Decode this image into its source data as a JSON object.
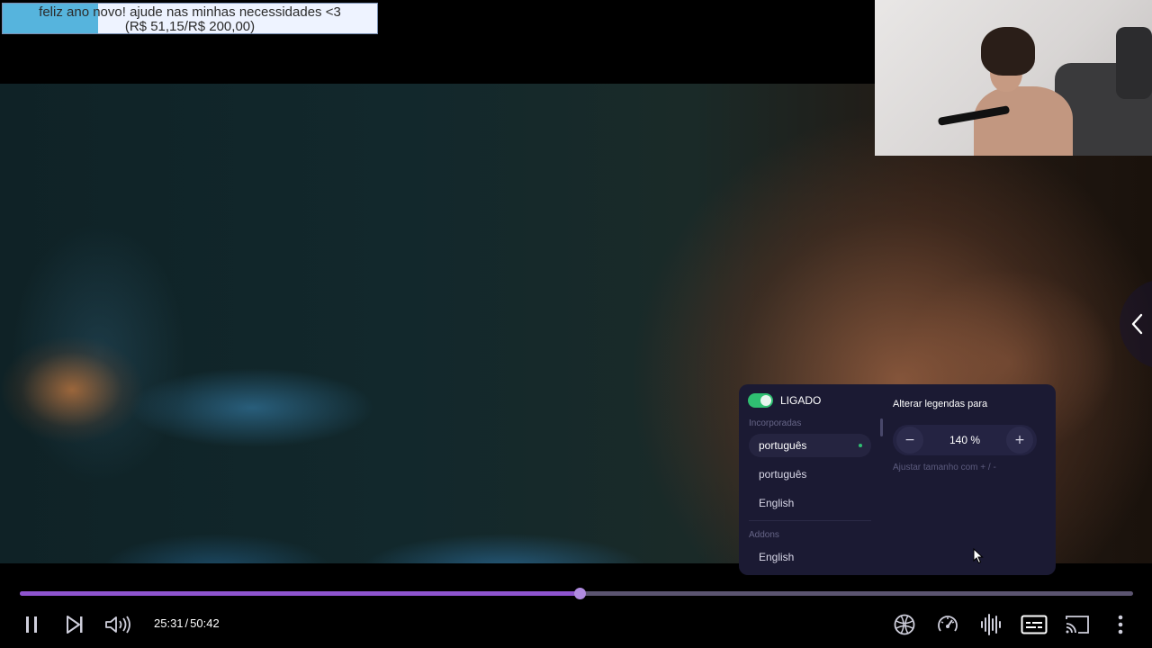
{
  "donation": {
    "line1": "feliz ano novo! ajude nas minhas necessidades <3",
    "line2": "(R$ 51,15/R$ 200,00)",
    "progress_fraction": 0.2558,
    "fill_color": "#56b4dd"
  },
  "subtitles_panel": {
    "toggle_label": "LIGADO",
    "toggle_on": true,
    "embedded_group_label": "Incorporadas",
    "embedded_tracks": [
      {
        "label": "português",
        "selected": true
      },
      {
        "label": "português",
        "selected": false
      },
      {
        "label": "English",
        "selected": false
      }
    ],
    "addons_group_label": "Addons",
    "addon_tracks": [
      {
        "label": "English",
        "selected": false
      }
    ],
    "size_title": "Alterar legendas para",
    "size_value": "140 %",
    "decrease_symbol": "−",
    "increase_symbol": "+",
    "size_hint": "Ajustar tamanho com  +  /  -"
  },
  "player": {
    "current_time": "25:31",
    "time_separator": "/",
    "duration": "50:42",
    "progress_fraction": 0.503,
    "accent_color": "#8e54cf",
    "controls_left": [
      "pause-icon",
      "next-episode-icon",
      "volume-icon"
    ],
    "controls_right": [
      "stream-info-icon",
      "playback-speed-icon",
      "audio-tracks-icon",
      "subtitles-icon",
      "cast-icon",
      "more-options-icon"
    ]
  }
}
